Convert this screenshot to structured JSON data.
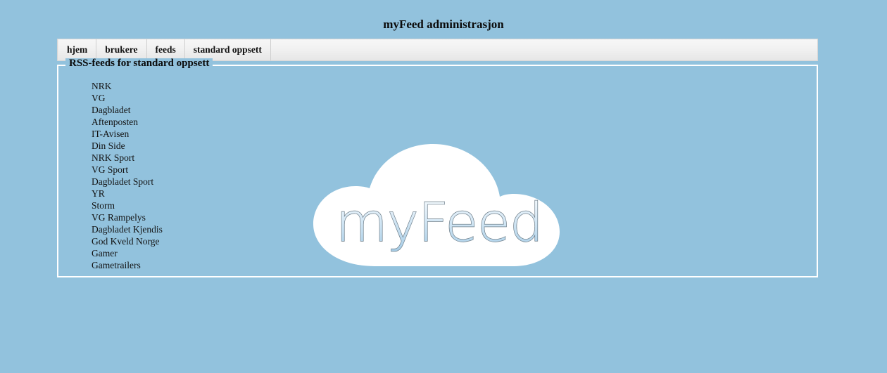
{
  "page": {
    "title": "myFeed administrasjon",
    "background_color": "#92c2dd"
  },
  "menu": {
    "name": "main-navigation",
    "tabs": [
      {
        "id": "hjem",
        "label": "hjem"
      },
      {
        "id": "brukere",
        "label": "brukere"
      },
      {
        "id": "feeds",
        "label": "feeds"
      },
      {
        "id": "standard-oppsett",
        "label": "standard oppsett"
      }
    ]
  },
  "panel": {
    "legend": "RSS-feeds for standard oppsett",
    "border_color": "#ffffff",
    "feeds": [
      {
        "label": "NRK"
      },
      {
        "label": "VG"
      },
      {
        "label": "Dagbladet"
      },
      {
        "label": "Aftenposten"
      },
      {
        "label": "IT-Avisen"
      },
      {
        "label": "Din Side"
      },
      {
        "label": "NRK Sport"
      },
      {
        "label": "VG Sport"
      },
      {
        "label": "Dagbladet Sport"
      },
      {
        "label": "YR"
      },
      {
        "label": "Storm"
      },
      {
        "label": "VG Rampelys"
      },
      {
        "label": "Dagbladet Kjendis"
      },
      {
        "label": "God Kveld Norge"
      },
      {
        "label": "Gamer"
      },
      {
        "label": "Gametrailers"
      }
    ]
  },
  "logo": {
    "name": "myfeed-cloud-logo",
    "wordmark": "myFeed",
    "cloud_color": "#ffffff",
    "text_gradient_top": "#ffffff",
    "text_gradient_bottom": "#a3cbe6",
    "text_outline_color": "#6d7d88"
  }
}
